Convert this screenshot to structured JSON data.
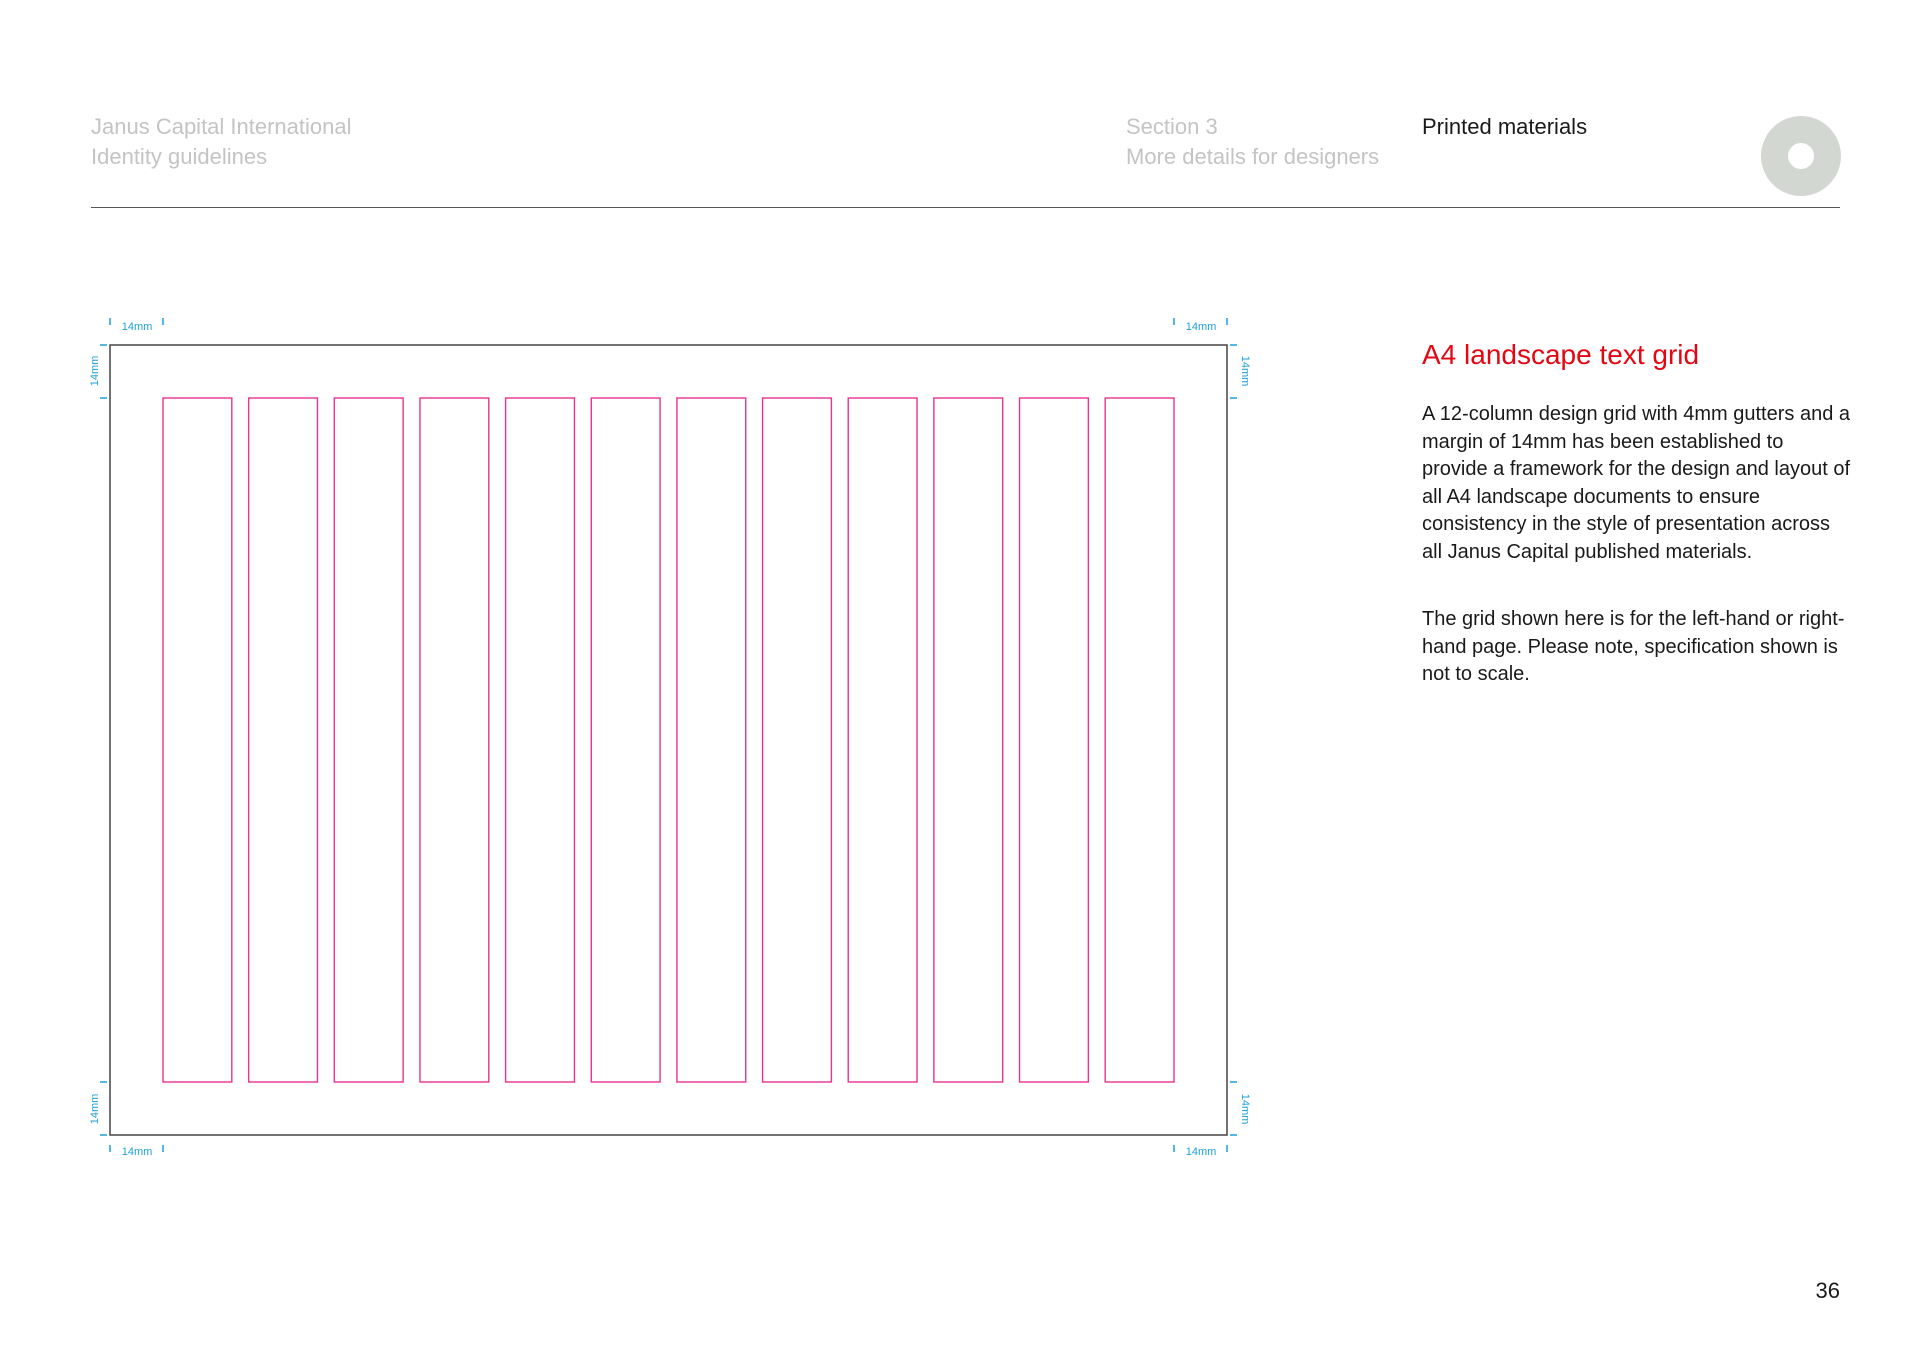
{
  "header": {
    "brand_line1": "Janus Capital International",
    "brand_line2": "Identity guidelines",
    "section_line1": "Section 3",
    "section_line2": "More details for designers",
    "current": "Printed materials",
    "icon": "ring-icon"
  },
  "diagram": {
    "margin_label": "14mm",
    "columns": 12,
    "gutter_mm": 4,
    "margin_mm": 14,
    "page_border_color": "#444444",
    "grid_color": "#e8338f",
    "dimension_color": "#1ca0d8"
  },
  "content": {
    "title": "A4 landscape text grid",
    "paragraph1": "A 12-column design grid with 4mm gutters and a margin of 14mm has been established to provide a framework for the design and layout of all A4 landscape documents to ensure consistency in the style of presentation across all Janus Capital published materials.",
    "paragraph2": "The grid shown here is for the left-hand or right-hand page. Please note, specification shown is not to scale."
  },
  "footer": {
    "page_number": "36"
  },
  "colors": {
    "accent": "#e30613",
    "header_muted": "#c4c4c4",
    "icon_ring": "#d3d7d2"
  }
}
